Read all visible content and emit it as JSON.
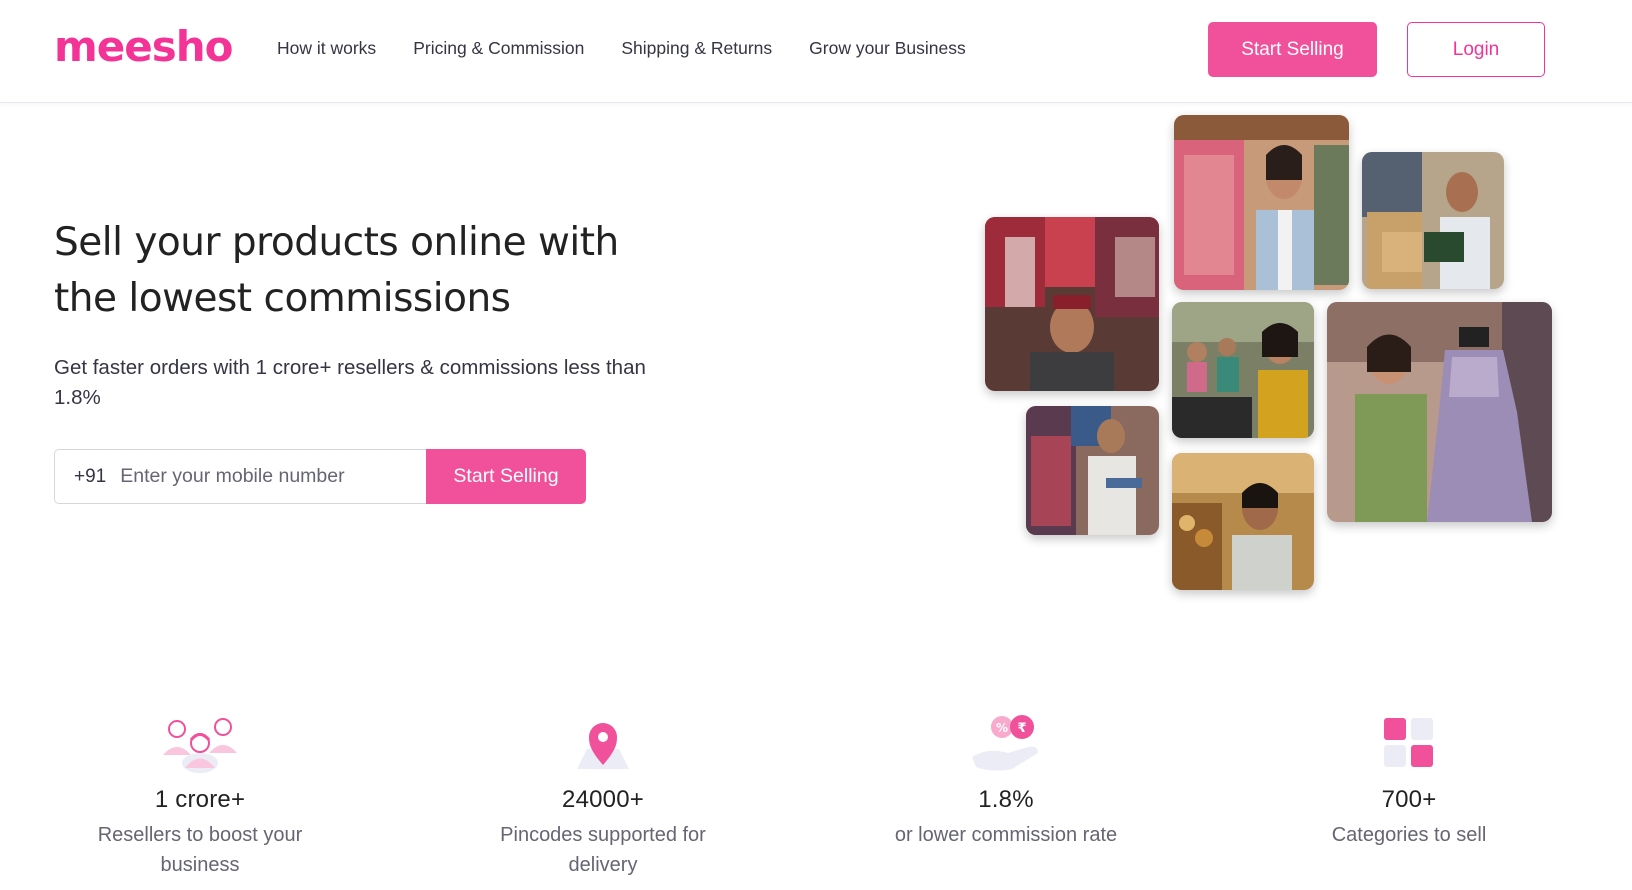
{
  "header": {
    "logo": "meesho",
    "nav": [
      "How it works",
      "Pricing & Commission",
      "Shipping & Returns",
      "Grow your Business"
    ],
    "start_selling": "Start Selling",
    "login": "Login"
  },
  "hero": {
    "title": "Sell your products online with the lowest commissions",
    "subtitle": "Get faster orders with 1 crore+ resellers & commissions less than 1.8%",
    "phone_prefix": "+91",
    "phone_placeholder": "Enter your mobile number",
    "cta": "Start Selling"
  },
  "stats": [
    {
      "icon": "resellers-group-icon",
      "value": "1 crore+",
      "label": "Resellers to boost your business"
    },
    {
      "icon": "location-pin-icon",
      "value": "24000+",
      "label": "Pincodes supported for delivery"
    },
    {
      "icon": "commission-hand-icon",
      "value": "1.8%",
      "label": "or lower commission rate"
    },
    {
      "icon": "categories-grid-icon",
      "value": "700+",
      "label": "Categories to sell"
    }
  ],
  "colors": {
    "brand": "#f43397",
    "button": "#f0519a",
    "text": "#353543"
  }
}
